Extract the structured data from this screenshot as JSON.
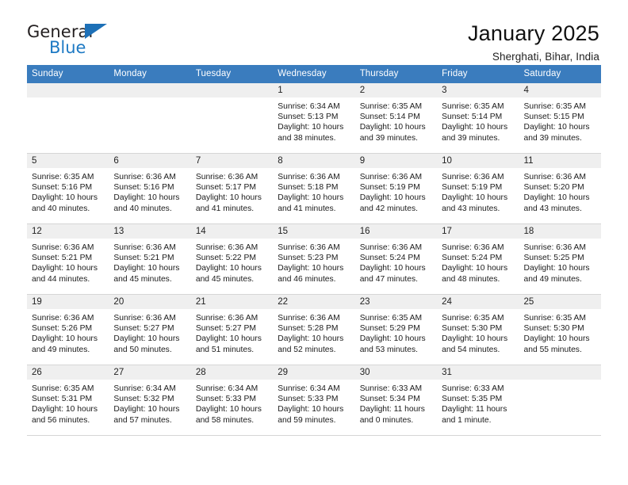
{
  "brand": {
    "name_part1": "General",
    "name_part2": "Blue",
    "flag_icon": "triangle-flag-icon"
  },
  "header": {
    "title": "January 2025",
    "subtitle": "Sherghati, Bihar, India"
  },
  "calendar": {
    "weekday_headers": [
      "Sunday",
      "Monday",
      "Tuesday",
      "Wednesday",
      "Thursday",
      "Friday",
      "Saturday"
    ],
    "accent_color": "#3a7cbe",
    "daynum_bg": "#efefef",
    "weeks": [
      [
        {
          "day": "",
          "empty": true
        },
        {
          "day": "",
          "empty": true
        },
        {
          "day": "",
          "empty": true
        },
        {
          "day": "1",
          "sunrise": "Sunrise: 6:34 AM",
          "sunset": "Sunset: 5:13 PM",
          "daylight_line1": "Daylight: 10 hours",
          "daylight_line2": "and 38 minutes."
        },
        {
          "day": "2",
          "sunrise": "Sunrise: 6:35 AM",
          "sunset": "Sunset: 5:14 PM",
          "daylight_line1": "Daylight: 10 hours",
          "daylight_line2": "and 39 minutes."
        },
        {
          "day": "3",
          "sunrise": "Sunrise: 6:35 AM",
          "sunset": "Sunset: 5:14 PM",
          "daylight_line1": "Daylight: 10 hours",
          "daylight_line2": "and 39 minutes."
        },
        {
          "day": "4",
          "sunrise": "Sunrise: 6:35 AM",
          "sunset": "Sunset: 5:15 PM",
          "daylight_line1": "Daylight: 10 hours",
          "daylight_line2": "and 39 minutes."
        }
      ],
      [
        {
          "day": "5",
          "sunrise": "Sunrise: 6:35 AM",
          "sunset": "Sunset: 5:16 PM",
          "daylight_line1": "Daylight: 10 hours",
          "daylight_line2": "and 40 minutes."
        },
        {
          "day": "6",
          "sunrise": "Sunrise: 6:36 AM",
          "sunset": "Sunset: 5:16 PM",
          "daylight_line1": "Daylight: 10 hours",
          "daylight_line2": "and 40 minutes."
        },
        {
          "day": "7",
          "sunrise": "Sunrise: 6:36 AM",
          "sunset": "Sunset: 5:17 PM",
          "daylight_line1": "Daylight: 10 hours",
          "daylight_line2": "and 41 minutes."
        },
        {
          "day": "8",
          "sunrise": "Sunrise: 6:36 AM",
          "sunset": "Sunset: 5:18 PM",
          "daylight_line1": "Daylight: 10 hours",
          "daylight_line2": "and 41 minutes."
        },
        {
          "day": "9",
          "sunrise": "Sunrise: 6:36 AM",
          "sunset": "Sunset: 5:19 PM",
          "daylight_line1": "Daylight: 10 hours",
          "daylight_line2": "and 42 minutes."
        },
        {
          "day": "10",
          "sunrise": "Sunrise: 6:36 AM",
          "sunset": "Sunset: 5:19 PM",
          "daylight_line1": "Daylight: 10 hours",
          "daylight_line2": "and 43 minutes."
        },
        {
          "day": "11",
          "sunrise": "Sunrise: 6:36 AM",
          "sunset": "Sunset: 5:20 PM",
          "daylight_line1": "Daylight: 10 hours",
          "daylight_line2": "and 43 minutes."
        }
      ],
      [
        {
          "day": "12",
          "sunrise": "Sunrise: 6:36 AM",
          "sunset": "Sunset: 5:21 PM",
          "daylight_line1": "Daylight: 10 hours",
          "daylight_line2": "and 44 minutes."
        },
        {
          "day": "13",
          "sunrise": "Sunrise: 6:36 AM",
          "sunset": "Sunset: 5:21 PM",
          "daylight_line1": "Daylight: 10 hours",
          "daylight_line2": "and 45 minutes."
        },
        {
          "day": "14",
          "sunrise": "Sunrise: 6:36 AM",
          "sunset": "Sunset: 5:22 PM",
          "daylight_line1": "Daylight: 10 hours",
          "daylight_line2": "and 45 minutes."
        },
        {
          "day": "15",
          "sunrise": "Sunrise: 6:36 AM",
          "sunset": "Sunset: 5:23 PM",
          "daylight_line1": "Daylight: 10 hours",
          "daylight_line2": "and 46 minutes."
        },
        {
          "day": "16",
          "sunrise": "Sunrise: 6:36 AM",
          "sunset": "Sunset: 5:24 PM",
          "daylight_line1": "Daylight: 10 hours",
          "daylight_line2": "and 47 minutes."
        },
        {
          "day": "17",
          "sunrise": "Sunrise: 6:36 AM",
          "sunset": "Sunset: 5:24 PM",
          "daylight_line1": "Daylight: 10 hours",
          "daylight_line2": "and 48 minutes."
        },
        {
          "day": "18",
          "sunrise": "Sunrise: 6:36 AM",
          "sunset": "Sunset: 5:25 PM",
          "daylight_line1": "Daylight: 10 hours",
          "daylight_line2": "and 49 minutes."
        }
      ],
      [
        {
          "day": "19",
          "sunrise": "Sunrise: 6:36 AM",
          "sunset": "Sunset: 5:26 PM",
          "daylight_line1": "Daylight: 10 hours",
          "daylight_line2": "and 49 minutes."
        },
        {
          "day": "20",
          "sunrise": "Sunrise: 6:36 AM",
          "sunset": "Sunset: 5:27 PM",
          "daylight_line1": "Daylight: 10 hours",
          "daylight_line2": "and 50 minutes."
        },
        {
          "day": "21",
          "sunrise": "Sunrise: 6:36 AM",
          "sunset": "Sunset: 5:27 PM",
          "daylight_line1": "Daylight: 10 hours",
          "daylight_line2": "and 51 minutes."
        },
        {
          "day": "22",
          "sunrise": "Sunrise: 6:36 AM",
          "sunset": "Sunset: 5:28 PM",
          "daylight_line1": "Daylight: 10 hours",
          "daylight_line2": "and 52 minutes."
        },
        {
          "day": "23",
          "sunrise": "Sunrise: 6:35 AM",
          "sunset": "Sunset: 5:29 PM",
          "daylight_line1": "Daylight: 10 hours",
          "daylight_line2": "and 53 minutes."
        },
        {
          "day": "24",
          "sunrise": "Sunrise: 6:35 AM",
          "sunset": "Sunset: 5:30 PM",
          "daylight_line1": "Daylight: 10 hours",
          "daylight_line2": "and 54 minutes."
        },
        {
          "day": "25",
          "sunrise": "Sunrise: 6:35 AM",
          "sunset": "Sunset: 5:30 PM",
          "daylight_line1": "Daylight: 10 hours",
          "daylight_line2": "and 55 minutes."
        }
      ],
      [
        {
          "day": "26",
          "sunrise": "Sunrise: 6:35 AM",
          "sunset": "Sunset: 5:31 PM",
          "daylight_line1": "Daylight: 10 hours",
          "daylight_line2": "and 56 minutes."
        },
        {
          "day": "27",
          "sunrise": "Sunrise: 6:34 AM",
          "sunset": "Sunset: 5:32 PM",
          "daylight_line1": "Daylight: 10 hours",
          "daylight_line2": "and 57 minutes."
        },
        {
          "day": "28",
          "sunrise": "Sunrise: 6:34 AM",
          "sunset": "Sunset: 5:33 PM",
          "daylight_line1": "Daylight: 10 hours",
          "daylight_line2": "and 58 minutes."
        },
        {
          "day": "29",
          "sunrise": "Sunrise: 6:34 AM",
          "sunset": "Sunset: 5:33 PM",
          "daylight_line1": "Daylight: 10 hours",
          "daylight_line2": "and 59 minutes."
        },
        {
          "day": "30",
          "sunrise": "Sunrise: 6:33 AM",
          "sunset": "Sunset: 5:34 PM",
          "daylight_line1": "Daylight: 11 hours",
          "daylight_line2": "and 0 minutes."
        },
        {
          "day": "31",
          "sunrise": "Sunrise: 6:33 AM",
          "sunset": "Sunset: 5:35 PM",
          "daylight_line1": "Daylight: 11 hours",
          "daylight_line2": "and 1 minute."
        },
        {
          "day": "",
          "empty": true
        }
      ]
    ]
  }
}
